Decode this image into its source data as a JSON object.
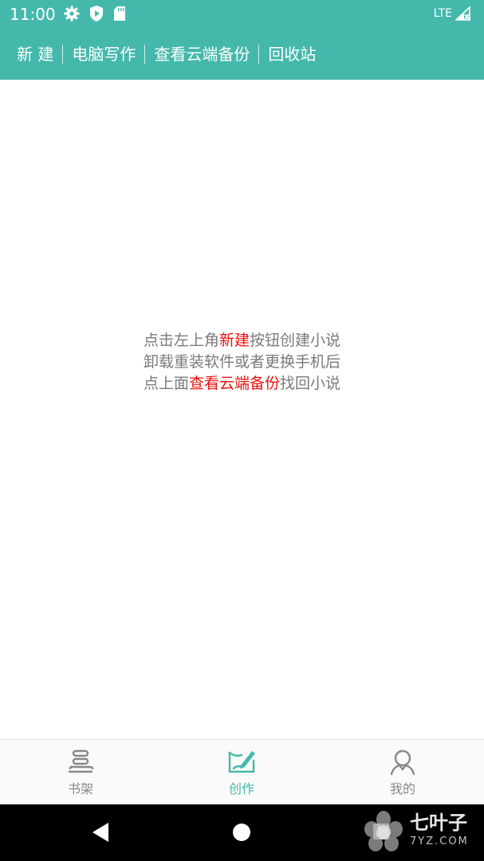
{
  "status_bar": {
    "time": "11:00",
    "network": "LTE",
    "icons": [
      "gear-icon",
      "play-protect-icon",
      "sd-card-icon",
      "signal-icon"
    ]
  },
  "toolbar": {
    "new_label": "新 建",
    "pc_write_label": "电脑写作",
    "cloud_backup_label": "查看云端备份",
    "recycle_bin_label": "回收站"
  },
  "empty_message": {
    "line1_part1": "点击左上角",
    "line1_highlight": "新建",
    "line1_part2": "按钮创建小说",
    "line2": "卸载重装软件或者更换手机后",
    "line3_part1": "点上面",
    "line3_highlight": "查看云端备份",
    "line3_part2": "找回小说"
  },
  "bottom_nav": {
    "items": [
      {
        "label": "书架",
        "icon": "bookshelf-icon",
        "active": false
      },
      {
        "label": "创作",
        "icon": "write-icon",
        "active": true
      },
      {
        "label": "我的",
        "icon": "profile-icon",
        "active": false
      }
    ]
  },
  "watermark": {
    "text": "七叶子",
    "sub": "7YZ.COM"
  },
  "colors": {
    "accent": "#45b8ac",
    "highlight": "#ee1111",
    "message_text": "#7a7a7a",
    "nav_inactive": "#888888"
  }
}
